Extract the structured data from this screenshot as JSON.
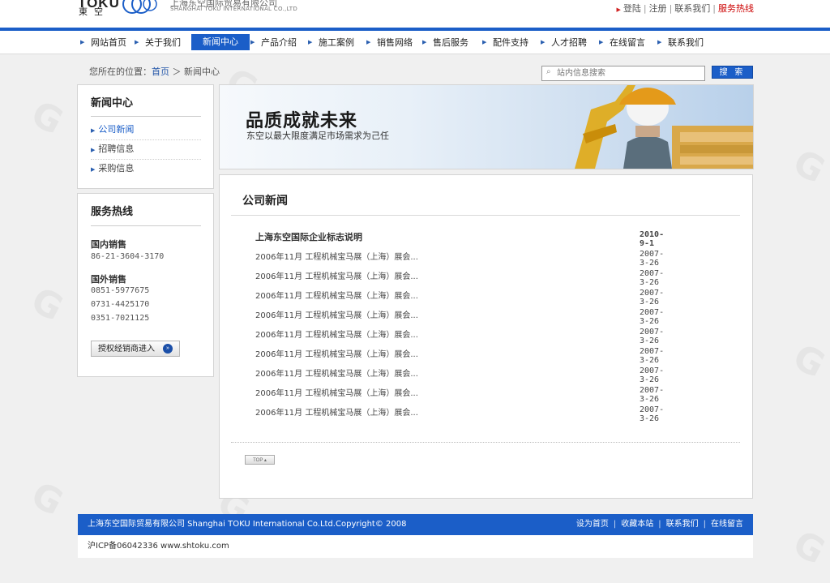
{
  "header": {
    "logo_en": "TOKU",
    "logo_cn": "東空",
    "company_cn": "上海东空国际贸易有限公司",
    "company_en": "SHANGHAI TOKU INTERNATIONAL CO.,LTD",
    "links": [
      "登陆",
      "注册",
      "联系我们",
      "服务热线"
    ]
  },
  "nav": {
    "items": [
      "网站首页",
      "关于我们",
      "新闻中心",
      "产品介绍",
      "施工案例",
      "销售网络",
      "售后服务",
      "配件支持",
      "人才招聘",
      "在线留言",
      "联系我们"
    ],
    "active_index": 2
  },
  "breadcrumb": {
    "prefix": "您所在的位置：",
    "home": "首页",
    "sep": "＞",
    "current": "新闻中心"
  },
  "search": {
    "placeholder": "站内信息搜索",
    "button": "搜 索"
  },
  "sidebar": {
    "news": {
      "title": "新闻中心",
      "items": [
        "公司新闻",
        "招聘信息",
        "采购信息"
      ]
    },
    "hotline": {
      "title": "服务热线",
      "domestic_label": "国内销售",
      "domestic_numbers": [
        "86-21-3604-3170"
      ],
      "overseas_label": "国外销售",
      "overseas_numbers": [
        "0851-5977675",
        "0731-4425170",
        "0351-7021125"
      ],
      "dealer_button": "授权经销商进入"
    }
  },
  "banner": {
    "title": "品质成就未来",
    "subtitle": "东空以最大限度满足市场需求为己任"
  },
  "main": {
    "title": "公司新闻",
    "news": [
      {
        "title": "上海东空国际企业标志说明",
        "date": "2010-9-1"
      },
      {
        "title": "2006年11月 工程机械宝马展（上海）展会...",
        "date": "2007-3-26"
      },
      {
        "title": "2006年11月 工程机械宝马展（上海）展会...",
        "date": "2007-3-26"
      },
      {
        "title": "2006年11月 工程机械宝马展（上海）展会...",
        "date": "2007-3-26"
      },
      {
        "title": "2006年11月 工程机械宝马展（上海）展会...",
        "date": "2007-3-26"
      },
      {
        "title": "2006年11月 工程机械宝马展（上海）展会...",
        "date": "2007-3-26"
      },
      {
        "title": "2006年11月 工程机械宝马展（上海）展会...",
        "date": "2007-3-26"
      },
      {
        "title": "2006年11月 工程机械宝马展（上海）展会...",
        "date": "2007-3-26"
      },
      {
        "title": "2006年11月 工程机械宝马展（上海）展会...",
        "date": "2007-3-26"
      },
      {
        "title": "2006年11月 工程机械宝马展（上海）展会...",
        "date": "2007-3-26"
      }
    ],
    "top_button": "TOP"
  },
  "footer": {
    "copyright": "上海东空国际贸易有限公司 Shanghai TOKU International Co.Ltd.Copyright© 2008",
    "links": [
      "设为首页",
      "收藏本站",
      "联系我们",
      "在线留言"
    ],
    "icp": "沪ICP备06042336 www.shtoku.com"
  },
  "colors": {
    "brand_blue": "#1b5ec8",
    "hotline_red": "#c00000"
  }
}
